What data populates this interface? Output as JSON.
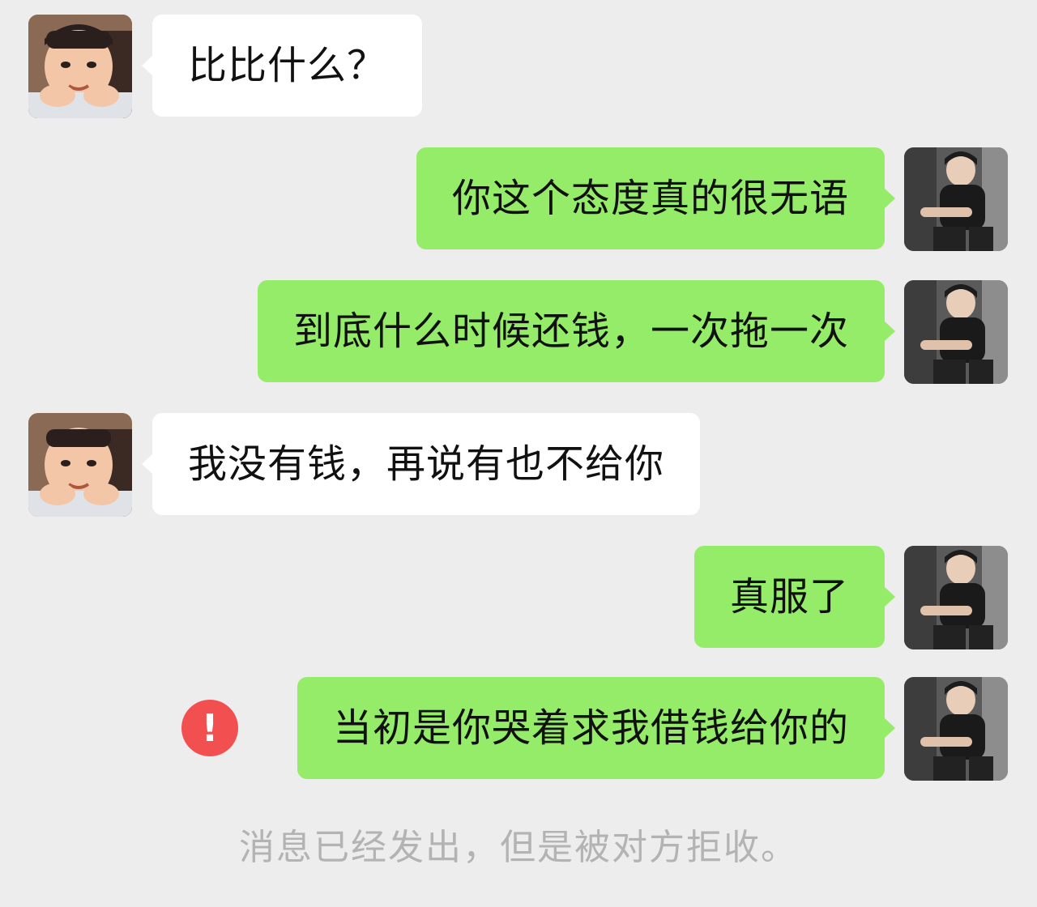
{
  "messages": [
    {
      "side": "received",
      "text": "比比什么？",
      "avatar": "child-face-avatar"
    },
    {
      "side": "sent",
      "text": "你这个态度真的很无语",
      "avatar": "young-man-avatar"
    },
    {
      "side": "sent",
      "text": "到底什么时候还钱，一次拖一次",
      "avatar": "young-man-avatar"
    },
    {
      "side": "received",
      "text": "我没有钱，再说有也不给你",
      "avatar": "child-face-avatar"
    },
    {
      "side": "sent",
      "text": "真服了",
      "avatar": "young-man-avatar"
    },
    {
      "side": "sent",
      "text": "当初是你哭着求我借钱给你的",
      "avatar": "young-man-avatar",
      "status": "failed"
    }
  ],
  "error_icon": {
    "glyph": "!",
    "color": "#f25050"
  },
  "system_note": "消息已经发出，但是被对方拒收。",
  "colors": {
    "background": "#ededed",
    "sent_bubble": "#95ec69",
    "received_bubble": "#ffffff",
    "system_text": "#b3b3b3"
  }
}
